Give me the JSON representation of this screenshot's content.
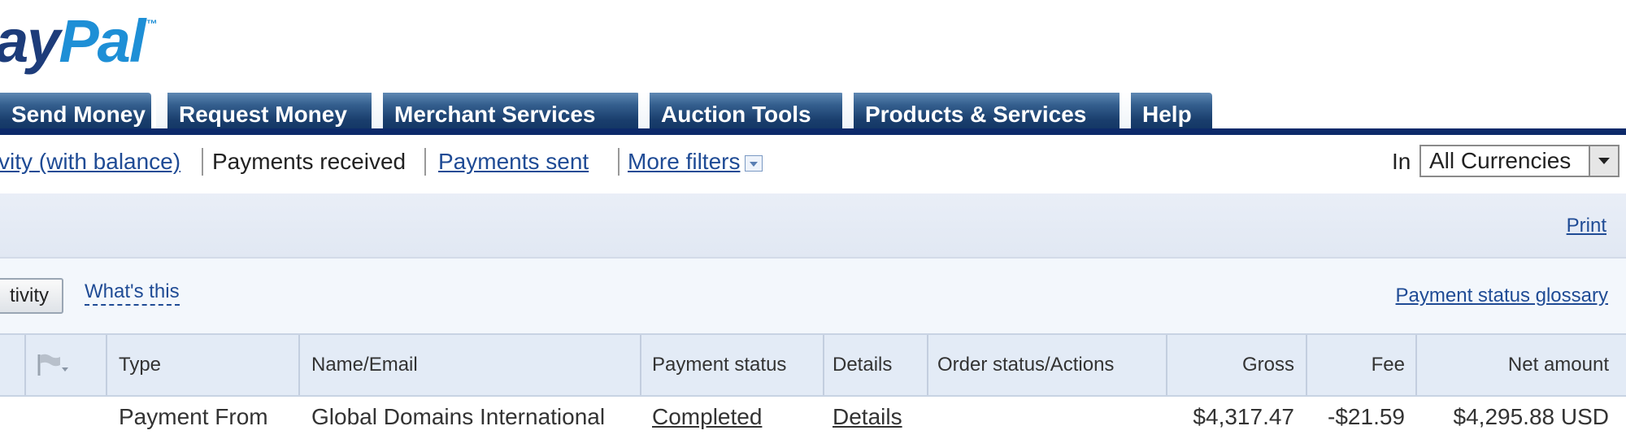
{
  "logo": {
    "text_a": "ay",
    "text_b": "Pal",
    "tm": "™"
  },
  "tabs": [
    {
      "label": "Send Money"
    },
    {
      "label": "Request Money"
    },
    {
      "label": "Merchant Services"
    },
    {
      "label": "Auction Tools"
    },
    {
      "label": "Products & Services"
    },
    {
      "label": "Help"
    }
  ],
  "subnav": {
    "activity_with_balance": "vity (with balance)",
    "payments_received": "Payments received",
    "payments_sent": "Payments sent",
    "more_filters": "More filters"
  },
  "currency": {
    "label": "In",
    "selected": "All Currencies"
  },
  "print_label": "Print",
  "activity_button": "tivity",
  "whats_this": "What's this",
  "glossary_link": "Payment status glossary",
  "table": {
    "headers": {
      "type": "Type",
      "name_email": "Name/Email",
      "payment_status": "Payment status",
      "details": "Details",
      "order_status": "Order status/Actions",
      "gross": "Gross",
      "fee": "Fee",
      "net": "Net amount"
    },
    "rows": [
      {
        "type": "Payment From",
        "name": "Global Domains International",
        "status": "Completed",
        "details": "Details",
        "gross": "$4,317.47",
        "fee": "-$21.59",
        "net": "$4,295.88 USD"
      }
    ]
  },
  "colors": {
    "brand_dark": "#1d3c7a",
    "brand_light": "#1e8fd6",
    "tab_rule": "#0d2a6a",
    "link": "#1f4b95"
  }
}
